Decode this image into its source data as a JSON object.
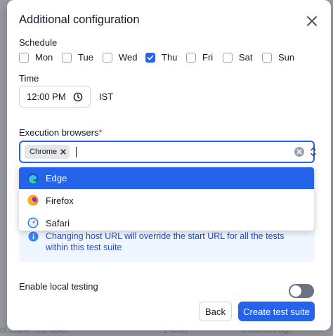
{
  "modal": {
    "title": "Additional configuration"
  },
  "schedule": {
    "label": "Schedule",
    "days": [
      {
        "label": "Mon",
        "checked": false
      },
      {
        "label": "Tue",
        "checked": false
      },
      {
        "label": "Wed",
        "checked": false
      },
      {
        "label": "Thu",
        "checked": true
      },
      {
        "label": "Fri",
        "checked": false
      },
      {
        "label": "Sat",
        "checked": false
      },
      {
        "label": "Sun",
        "checked": false
      }
    ]
  },
  "time": {
    "label": "Time",
    "value": "12:00 PM",
    "timezone": "IST"
  },
  "browsers": {
    "label": "Execution browsers",
    "required_mark": "*",
    "selected": [
      "Chrome"
    ],
    "options": [
      {
        "label": "Edge",
        "icon": "edge-icon",
        "highlighted": true
      },
      {
        "label": "Firefox",
        "icon": "firefox-icon",
        "highlighted": false
      },
      {
        "label": "Safari",
        "icon": "safari-icon",
        "highlighted": false
      }
    ]
  },
  "info": {
    "text": "Changing host URL will override the start URL for all the tests within this test suite"
  },
  "local_testing": {
    "label": "Enable local testing",
    "enabled": false
  },
  "footer": {
    "back_label": "Back",
    "create_label": "Create test suite"
  },
  "background": {
    "row_text": "ci Stack Test Suite",
    "row_tests": "1 tests",
    "row_time": "3 months ago"
  },
  "colors": {
    "accent": "#2563eb",
    "info_bg": "#eff6ff",
    "info_text": "#1d4ed8",
    "required": "#dc2626"
  }
}
